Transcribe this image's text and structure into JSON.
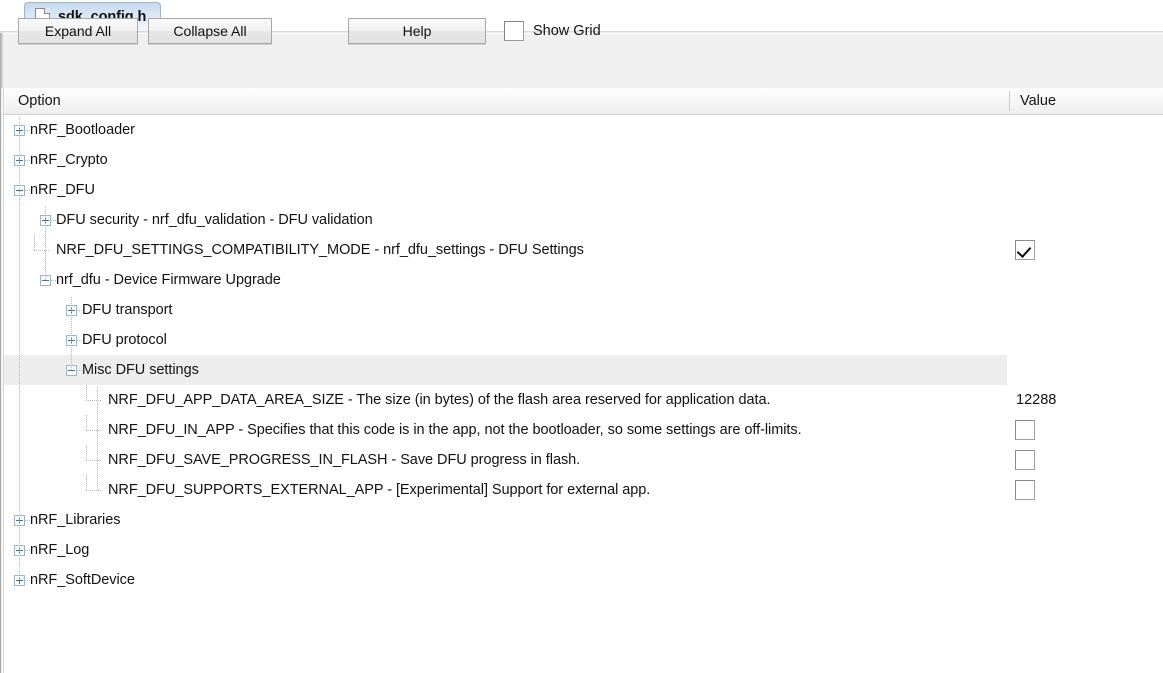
{
  "window": {
    "tab": {
      "title": "sdk_config.h",
      "icon": "document-icon"
    }
  },
  "toolbar": {
    "expand_all_label": "Expand All",
    "collapse_all_label": "Collapse All",
    "help_label": "Help",
    "show_grid_label": "Show Grid",
    "show_grid_checked": false
  },
  "grid": {
    "columns": {
      "option": "Option",
      "value": "Value"
    },
    "rows": [
      {
        "label": "nRF_Bootloader",
        "depth": 0,
        "expander": "plus",
        "value_type": "none",
        "value": "",
        "selected": false
      },
      {
        "label": "nRF_Crypto",
        "depth": 0,
        "expander": "plus",
        "value_type": "none",
        "value": "",
        "selected": false
      },
      {
        "label": "nRF_DFU",
        "depth": 0,
        "expander": "minus",
        "value_type": "none",
        "value": "",
        "selected": false
      },
      {
        "label": "DFU security - nrf_dfu_validation - DFU validation",
        "depth": 1,
        "expander": "plus",
        "value_type": "none",
        "value": "",
        "selected": false
      },
      {
        "label": "NRF_DFU_SETTINGS_COMPATIBILITY_MODE  - nrf_dfu_settings - DFU Settings",
        "depth": 1,
        "expander": "leaf",
        "value_type": "checkbox",
        "value": "checked",
        "selected": false
      },
      {
        "label": "nrf_dfu - Device Firmware Upgrade",
        "depth": 1,
        "expander": "minus",
        "value_type": "none",
        "value": "",
        "selected": false
      },
      {
        "label": "DFU transport",
        "depth": 2,
        "expander": "plus",
        "value_type": "none",
        "value": "",
        "selected": false
      },
      {
        "label": "DFU protocol",
        "depth": 2,
        "expander": "plus",
        "value_type": "none",
        "value": "",
        "selected": false
      },
      {
        "label": "Misc DFU settings",
        "depth": 2,
        "expander": "minus",
        "value_type": "none",
        "value": "",
        "selected": true
      },
      {
        "label": "NRF_DFU_APP_DATA_AREA_SIZE - The size (in bytes) of the flash area reserved for application data.",
        "depth": 3,
        "expander": "leaf",
        "value_type": "text",
        "value": "12288",
        "selected": false
      },
      {
        "label": "NRF_DFU_IN_APP  - Specifies that this code is in the app, not the bootloader, so some settings are off-limits.",
        "depth": 3,
        "expander": "leaf",
        "value_type": "checkbox",
        "value": "unchecked",
        "selected": false
      },
      {
        "label": "NRF_DFU_SAVE_PROGRESS_IN_FLASH  - Save DFU progress in flash.",
        "depth": 3,
        "expander": "leaf",
        "value_type": "checkbox",
        "value": "unchecked",
        "selected": false
      },
      {
        "label": "NRF_DFU_SUPPORTS_EXTERNAL_APP  - [Experimental] Support for external app.",
        "depth": 3,
        "expander": "leaf",
        "value_type": "checkbox",
        "value": "unchecked",
        "selected": false
      },
      {
        "label": "nRF_Libraries",
        "depth": 0,
        "expander": "plus",
        "value_type": "none",
        "value": "",
        "selected": false
      },
      {
        "label": "nRF_Log",
        "depth": 0,
        "expander": "plus",
        "value_type": "none",
        "value": "",
        "selected": false
      },
      {
        "label": "nRF_SoftDevice",
        "depth": 0,
        "expander": "plus",
        "value_type": "none",
        "value": "",
        "selected": false
      }
    ]
  },
  "colors": {
    "selection": "#ededed",
    "tab_accent": "#c6d9ef",
    "header_bg": "#f6f6f6",
    "tree_line": "#b9b9b9",
    "expander_border": "#9cb7cc"
  }
}
